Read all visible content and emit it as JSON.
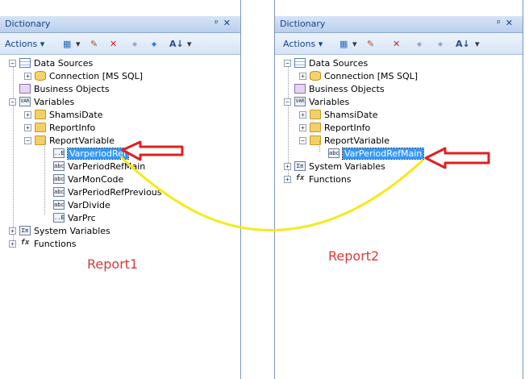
{
  "left": {
    "title": "Dictionary",
    "pin_glyph": "ᵖ ✕",
    "toolbar": {
      "actions_label": "Actions"
    },
    "tree": {
      "data_sources": "Data Sources",
      "connection": "Connection [MS SQL]",
      "business_objects": "Business Objects",
      "variables": "Variables",
      "shamsi": "ShamsiDate",
      "reportinfo": "ReportInfo",
      "reportvariable": "ReportVariable",
      "items": [
        "VarperiodRef",
        "VarPeriodRefMain",
        "VarMonCode",
        "VarPeriodRefPrevious",
        "VarDivide",
        "VarPrc"
      ],
      "system_variables": "System Variables",
      "functions": "Functions"
    },
    "report_label": "Report1"
  },
  "right": {
    "title": "Dictionary",
    "toolbar": {
      "actions_label": "Actions"
    },
    "tree": {
      "data_sources": "Data Sources",
      "connection": "Connection [MS SQL]",
      "business_objects": "Business Objects",
      "variables": "Variables",
      "shamsi": "ShamsiDate",
      "reportinfo": "ReportInfo",
      "reportvariable": "ReportVariable",
      "items": [
        "VarPeriodRefMain"
      ],
      "system_variables": "System Variables",
      "functions": "Functions"
    },
    "report_label": "Report2"
  },
  "icons": {
    "expand_plus": "+",
    "expand_minus": "−",
    "var_glyph_e": "..E",
    "var_glyph_abc": "abc",
    "var_glyph_var": "VAR",
    "sys_glyph": "Σ≡",
    "fx_glyph": "fx",
    "sort_glyph": "A↓",
    "dropdown_glyph": "▾",
    "delete_glyph": "✕",
    "up_glyph": "◆",
    "down_glyph": "◆",
    "edit_glyph": "✎",
    "new_glyph": "▦",
    "pin_glyph": "ᵖ",
    "close_glyph": "✕"
  },
  "colors": {
    "arrow_red": "#e02020",
    "curve_yellow": "#f5ea1a",
    "selection": "#3399ff"
  }
}
